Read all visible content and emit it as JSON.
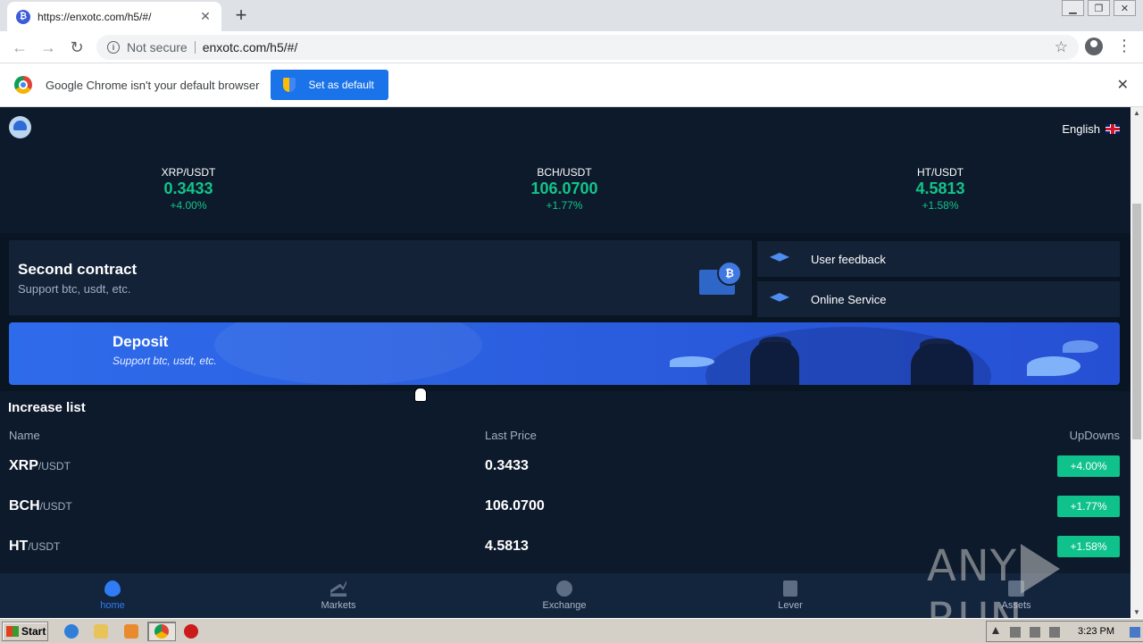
{
  "browser": {
    "tab_title": "https://enxotc.com/h5/#/",
    "tab_favicon": "bitcoin-icon",
    "new_tab": "+",
    "security_label": "Not secure",
    "url": "enxotc.com/h5/#/",
    "infobar_text": "Google Chrome isn't your default browser",
    "infobar_button": "Set as default"
  },
  "header": {
    "language": "English"
  },
  "tickers": [
    {
      "pair": "XRP/USDT",
      "price": "0.3433",
      "change": "+4.00%"
    },
    {
      "pair": "BCH/USDT",
      "price": "106.0700",
      "change": "+1.77%"
    },
    {
      "pair": "HT/USDT",
      "price": "4.5813",
      "change": "+1.58%"
    }
  ],
  "contract": {
    "title": "Second contract",
    "subtitle": "Support btc, usdt, etc."
  },
  "side_links": [
    {
      "label": "User feedback"
    },
    {
      "label": "Online Service"
    }
  ],
  "deposit": {
    "title": "Deposit",
    "subtitle": "Support btc, usdt, etc."
  },
  "increase_list": {
    "title": "Increase list",
    "columns": [
      "Name",
      "Last Price",
      "UpDowns"
    ],
    "rows": [
      {
        "base": "XRP",
        "quote": "/USDT",
        "price": "0.3433",
        "change": "+4.00%"
      },
      {
        "base": "BCH",
        "quote": "/USDT",
        "price": "106.0700",
        "change": "+1.77%"
      },
      {
        "base": "HT",
        "quote": "/USDT",
        "price": "4.5813",
        "change": "+1.58%"
      }
    ]
  },
  "bottom_nav": [
    {
      "label": "home",
      "active": true
    },
    {
      "label": "Markets",
      "active": false
    },
    {
      "label": "Exchange",
      "active": false
    },
    {
      "label": "Lever",
      "active": false
    },
    {
      "label": "Assets",
      "active": false
    }
  ],
  "watermark": {
    "left": "ANY",
    "right": "RUN"
  },
  "taskbar": {
    "start_label": "Start",
    "clock": "3:23 PM"
  },
  "colors": {
    "page_bg": "#0d1a2b",
    "up_green": "#12c48a",
    "accent_blue": "#2f7cf6"
  }
}
